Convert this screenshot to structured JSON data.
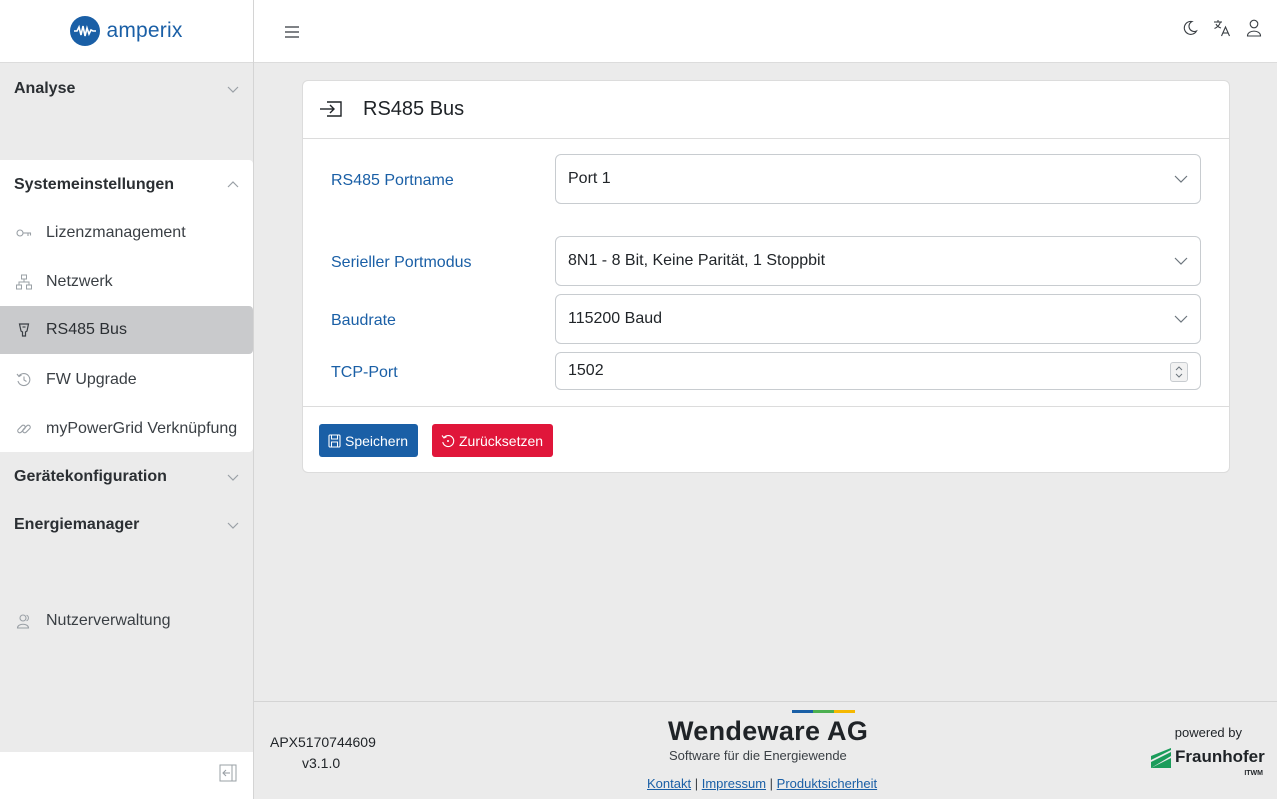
{
  "app": {
    "logo_text": "amperix"
  },
  "sidebar": {
    "sections": [
      {
        "label": "Analyse"
      },
      {
        "label": "Systemeinstellungen"
      },
      {
        "label": "Gerätekonfiguration"
      },
      {
        "label": "Energiemanager"
      }
    ],
    "items": [
      {
        "label": "Lizenzmanagement",
        "icon": "key-icon"
      },
      {
        "label": "Netzwerk",
        "icon": "network-icon"
      },
      {
        "label": "RS485 Bus",
        "icon": "plug-icon",
        "active": true
      },
      {
        "label": "FW Upgrade",
        "icon": "history-icon"
      },
      {
        "label": "myPowerGrid Verknüpfung",
        "icon": "link-icon"
      }
    ],
    "user_admin": {
      "label": "Nutzerverwaltung",
      "icon": "users-icon"
    }
  },
  "card": {
    "title": "RS485 Bus",
    "fields": [
      {
        "label": "RS485 Portname",
        "value": "Port 1"
      },
      {
        "label": "Serieller Portmodus",
        "value": "8N1 - 8 Bit, Keine Parität, 1 Stoppbit"
      },
      {
        "label": "Baudrate",
        "value": "115200 Baud"
      },
      {
        "label": "TCP-Port",
        "value": "1502"
      }
    ],
    "save_label": "Speichern",
    "reset_label": "Zurücksetzen"
  },
  "footer": {
    "serial": "APX5170744609",
    "version": "v3.1.0",
    "company": "Wendeware AG",
    "tagline": "Software für die Energiewende",
    "links": [
      "Kontakt",
      "Impressum",
      "Produktsicherheit"
    ],
    "powered_by": "powered by",
    "partner": "Fraunhofer",
    "partner_sub": "ITWM"
  },
  "colors": {
    "primary": "#1a5fa6",
    "danger": "#e0163a",
    "bar_blue": "#1a5fa6",
    "bar_green": "#4caf50",
    "bar_yellow": "#f5b800"
  }
}
